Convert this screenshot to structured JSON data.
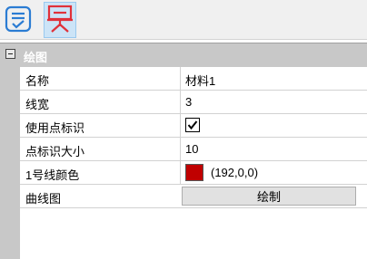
{
  "toolbar": {
    "buttons": [
      {
        "name": "checklist-icon",
        "active": false
      },
      {
        "name": "presentation-icon",
        "active": true
      }
    ]
  },
  "colors": {
    "icon_blue": "#2b7cd3",
    "icon_red": "#e0313a",
    "category_bg": "#c8c8c8",
    "swatch": "#c00000"
  },
  "grid": {
    "category": "绘图",
    "rows": {
      "name": {
        "label": "名称",
        "value": "材料1"
      },
      "line_width": {
        "label": "线宽",
        "value": "3"
      },
      "use_marker": {
        "label": "使用点标识",
        "checked": true
      },
      "marker_size": {
        "label": "点标识大小",
        "value": "10"
      },
      "line_color": {
        "label": "1号线颜色",
        "value": "(192,0,0)"
      },
      "curve": {
        "label": "曲线图",
        "button": "绘制"
      }
    }
  }
}
